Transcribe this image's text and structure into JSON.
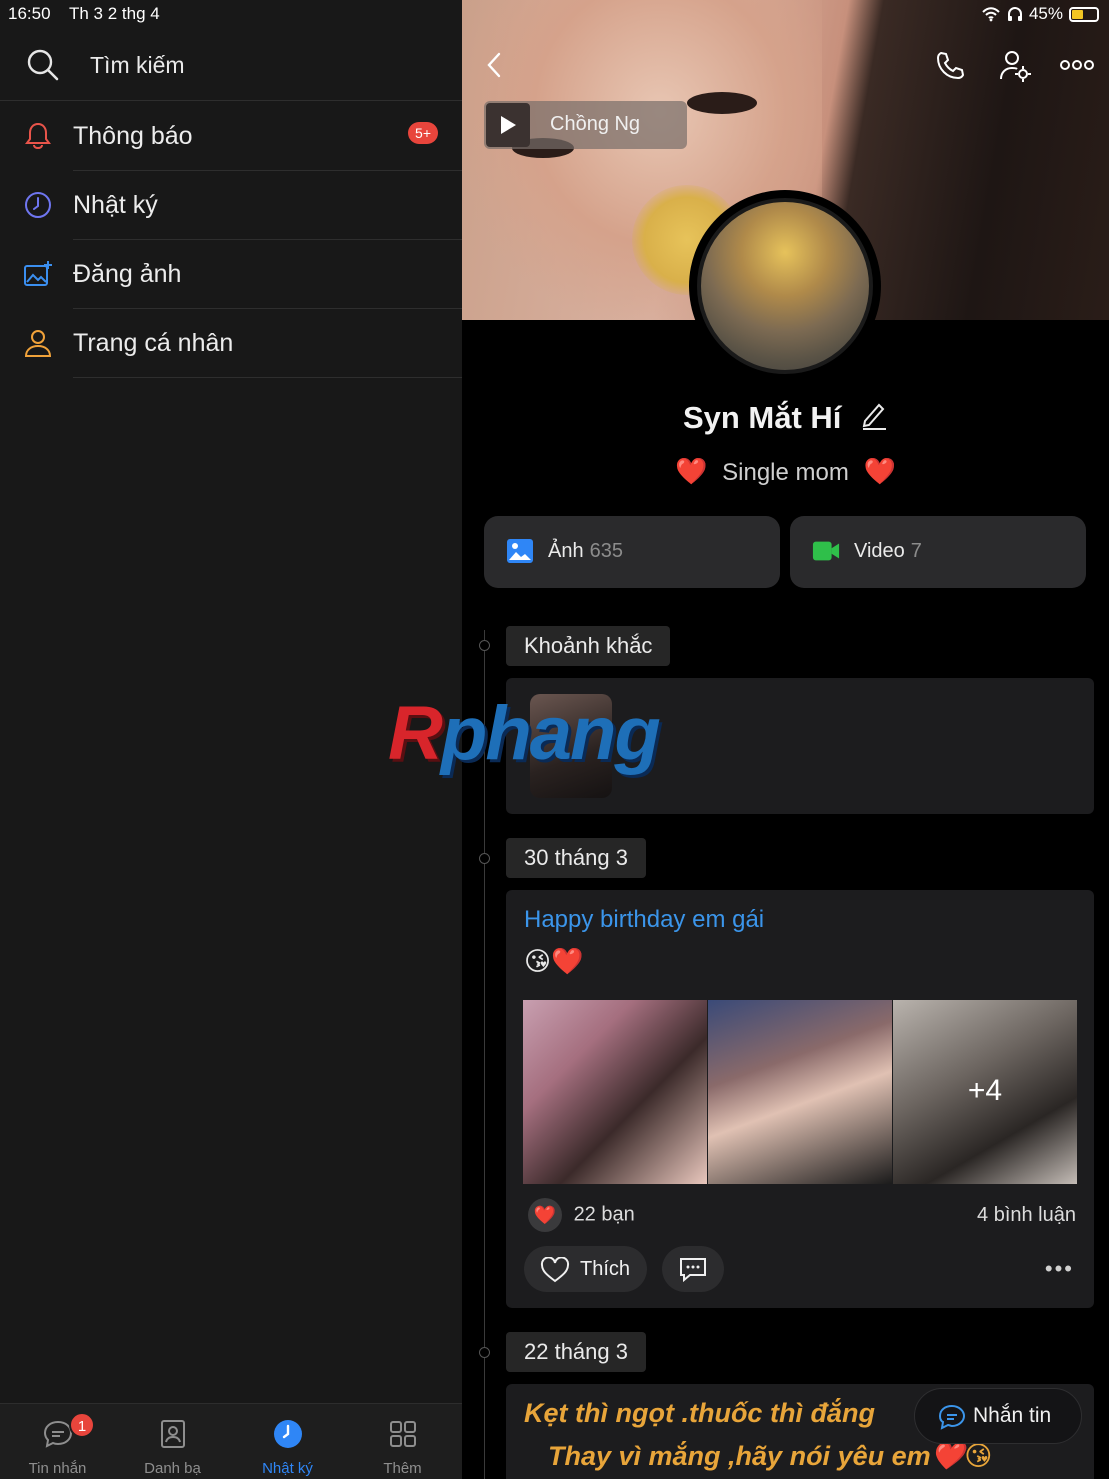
{
  "status": {
    "time": "16:50",
    "date": "Th 3 2 thg 4",
    "battery": "45%"
  },
  "left": {
    "search_label": "Tìm kiếm",
    "menu": [
      {
        "label": "Thông báo",
        "badge": "5+",
        "icon": "bell-icon"
      },
      {
        "label": "Nhật ký",
        "icon": "clock-icon"
      },
      {
        "label": "Đăng ảnh",
        "icon": "photo-add-icon"
      },
      {
        "label": "Trang cá nhân",
        "icon": "person-icon"
      }
    ],
    "tabs": [
      {
        "label": "Tin nhắn",
        "badge": "1"
      },
      {
        "label": "Danh bạ"
      },
      {
        "label": "Nhật ký",
        "active": true
      },
      {
        "label": "Thêm"
      }
    ]
  },
  "profile": {
    "music_title": "Chồng     Ng",
    "name": "Syn Mắt Hí",
    "status_heart_left": "❤️",
    "status_text": "Single mom",
    "status_heart_right": "❤️",
    "photos_label": "Ảnh",
    "photos_count": "635",
    "videos_label": "Video",
    "videos_count": "7"
  },
  "timeline": {
    "moments_label": "Khoảnh khắc",
    "post1": {
      "date": "30 tháng 3",
      "title": "Happy birthday em gái",
      "emoji": "😘❤️",
      "extra_photos": "+4",
      "reactions_icon": "❤️",
      "reactions": "22 bạn",
      "comments": "4 bình luận",
      "like_label": "Thích"
    },
    "post2": {
      "date": "22 tháng 3",
      "line1": "Kẹt thì ngọt .thuốc thì đắng",
      "line2": "Thay vì mắng ,hãy nói yêu em❤️😘"
    },
    "message_button": "Nhắn tin"
  },
  "watermark": {
    "part1": "R",
    "part2": "phang"
  },
  "colors": {
    "accent": "#2f86f6",
    "badge": "#e8453c",
    "heart": "#e8282e",
    "link": "#3b95ea",
    "quote": "#e8a53a"
  }
}
